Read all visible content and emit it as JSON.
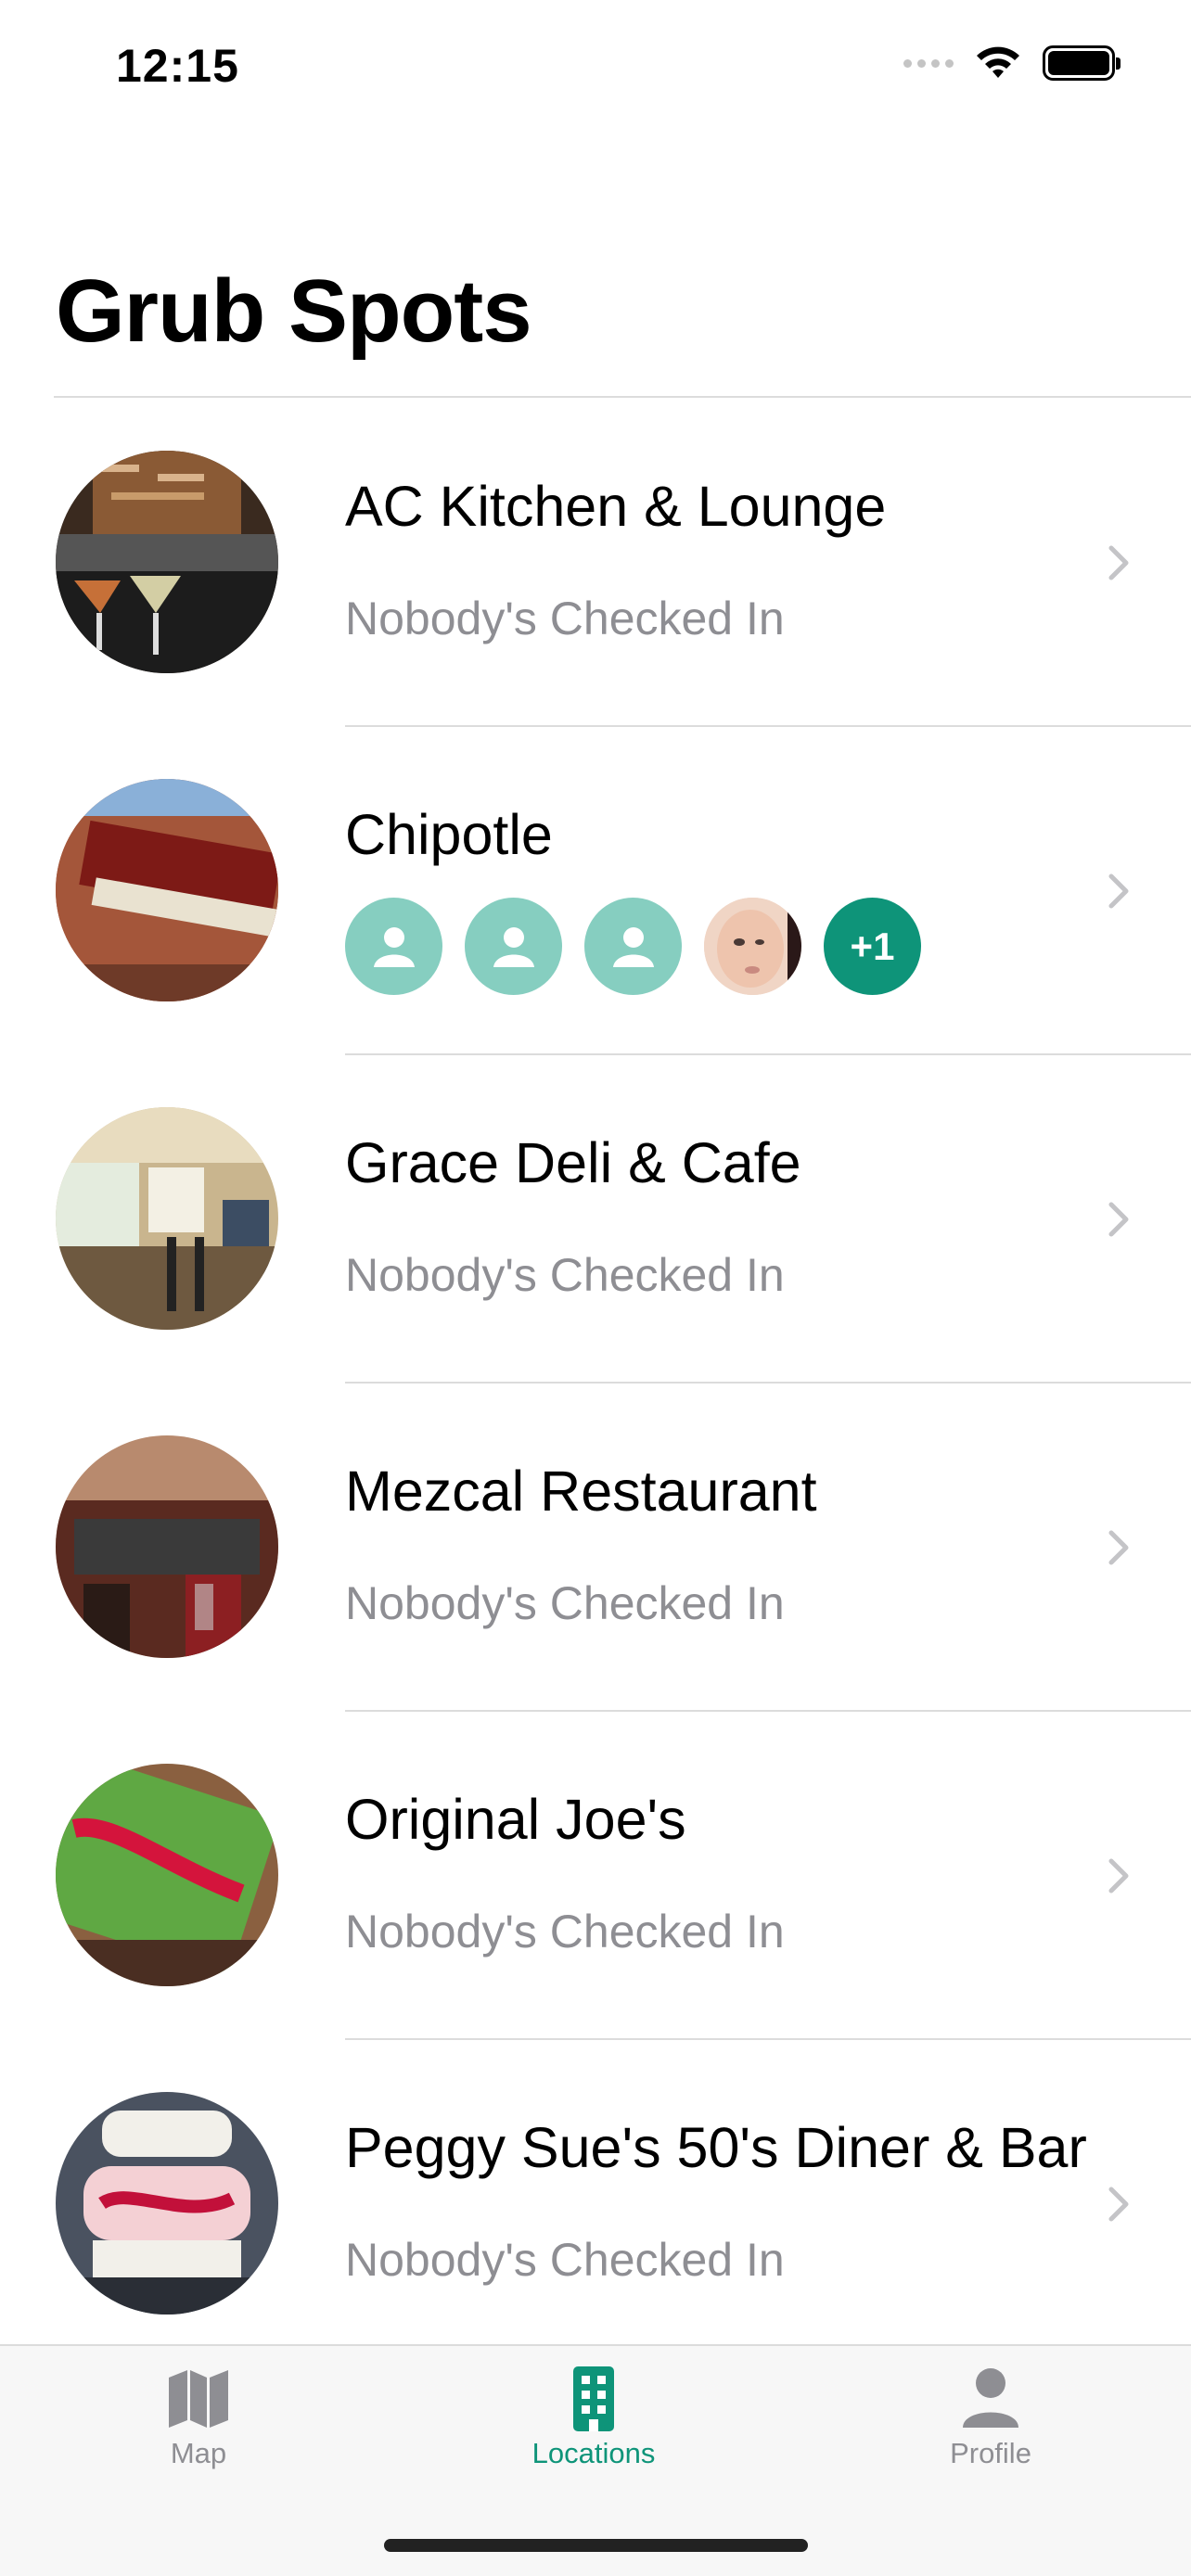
{
  "status_bar": {
    "time": "12:15"
  },
  "header": {
    "title": "Grub Spots"
  },
  "locations": [
    {
      "name": "AC Kitchen & Lounge",
      "subtitle": "Nobody's Checked In"
    },
    {
      "name": "Chipotle",
      "avatars": [
        "placeholder",
        "placeholder",
        "placeholder",
        "photo"
      ],
      "more_count": "+1"
    },
    {
      "name": "Grace Deli & Cafe",
      "subtitle": "Nobody's Checked In"
    },
    {
      "name": "Mezcal Restaurant",
      "subtitle": "Nobody's Checked In"
    },
    {
      "name": "Original Joe's",
      "subtitle": "Nobody's Checked In"
    },
    {
      "name": "Peggy Sue's 50's Diner & Bar",
      "subtitle": "Nobody's Checked In"
    }
  ],
  "tab_bar": {
    "tabs": [
      {
        "label": "Map",
        "icon": "map-icon",
        "active": false
      },
      {
        "label": "Locations",
        "icon": "building-icon",
        "active": true
      },
      {
        "label": "Profile",
        "icon": "person-icon",
        "active": false
      }
    ]
  },
  "colors": {
    "accent": "#0e9479",
    "placeholder_avatar": "#86cec0",
    "secondary_text": "#8e8e93"
  }
}
